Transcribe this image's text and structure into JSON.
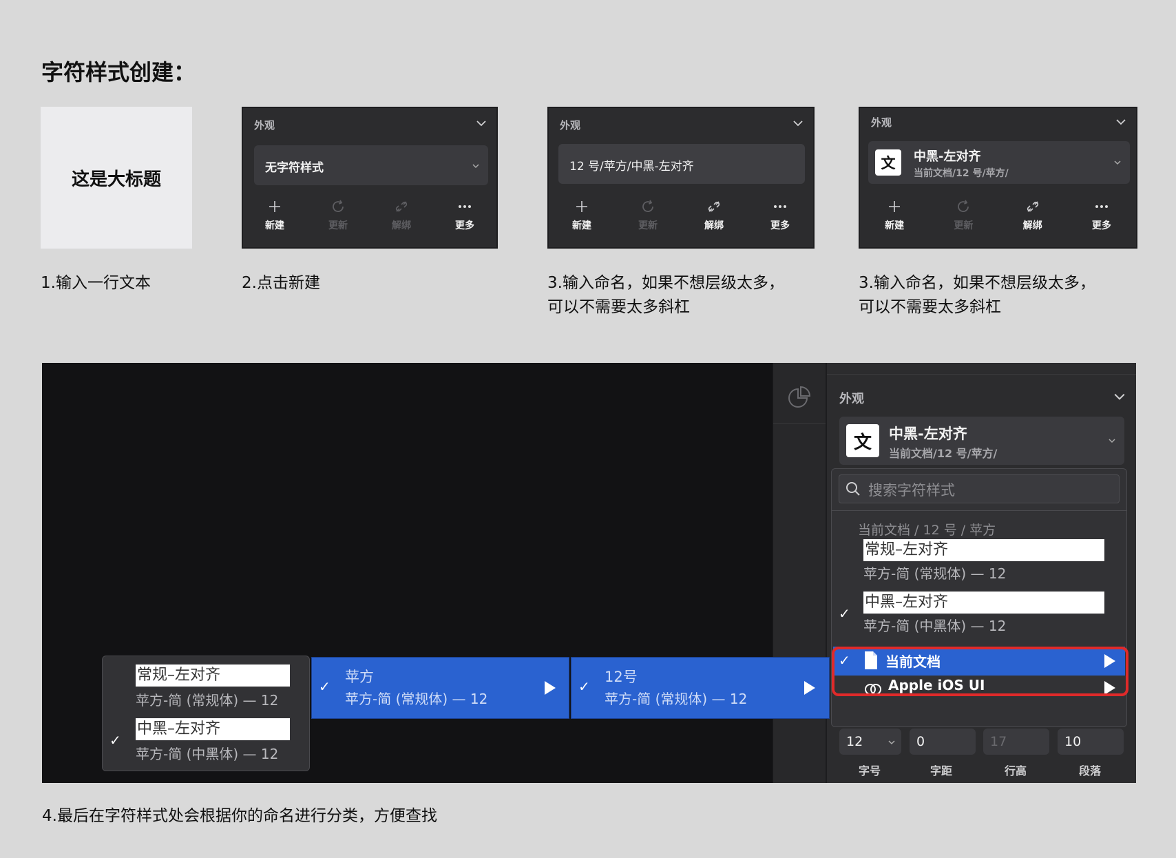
{
  "page_title": "字符样式创建：",
  "step1": {
    "card_text": "这是大标题",
    "caption": "1.输入一行文本"
  },
  "step2": {
    "header": "外观",
    "field_text": "无字符样式",
    "tools": [
      "新建",
      "更新",
      "解绑",
      "更多"
    ],
    "caption": "2.点击新建"
  },
  "step3a": {
    "header": "外观",
    "field_text": "12 号/苹方/中黑-左对齐",
    "tools": [
      "新建",
      "更新",
      "解绑",
      "更多"
    ],
    "caption_line1": "3.输入命名，如果不想层级太多，",
    "caption_line2": "可以不需要太多斜杠"
  },
  "step3b": {
    "header": "外观",
    "icon_char": "文",
    "style_name": "中黑-左对齐",
    "style_path": "当前文档/12 号/苹方/",
    "tools": [
      "新建",
      "更新",
      "解绑",
      "更多"
    ],
    "caption_line1": "3.输入命名，如果不想层级太多，",
    "caption_line2": "可以不需要太多斜杠"
  },
  "step4": {
    "panel_header": "外观",
    "icon_char": "文",
    "style_name": "中黑-左对齐",
    "style_path": "当前文档/12 号/苹方/",
    "search_placeholder": "搜索字符样式",
    "group_title": "当前文档 / 12 号 / 苹方",
    "items": [
      {
        "name": "常规–左对齐",
        "sub": "苹方-简 (常规体) — 12",
        "checked": false
      },
      {
        "name": "中黑–左对齐",
        "sub": "苹方-简 (中黑体) — 12",
        "checked": true
      }
    ],
    "current_doc_label": "当前文档",
    "apple_label": "Apple iOS UI",
    "bar_pingfang": {
      "title": "苹方",
      "sub": "苹方-简 (常规体) — 12"
    },
    "bar_12": {
      "title": "12号",
      "sub": "苹方-简 (常规体) — 12"
    },
    "left_menu_items": [
      {
        "name": "常规–左对齐",
        "sub": "苹方-简 (常规体) — 12"
      },
      {
        "name": "中黑–左对齐",
        "sub": "苹方-简 (中黑体) — 12"
      }
    ],
    "metrics": [
      {
        "value": "12",
        "label": "字号"
      },
      {
        "value": "0",
        "label": "字距"
      },
      {
        "value": "17",
        "label": "行高"
      },
      {
        "value": "10",
        "label": "段落"
      }
    ],
    "highlight_color": "#e02a2a",
    "selection_color": "#2a62d0",
    "caption": "4.最后在字符样式处会根据你的命名进行分类，方便查找"
  }
}
